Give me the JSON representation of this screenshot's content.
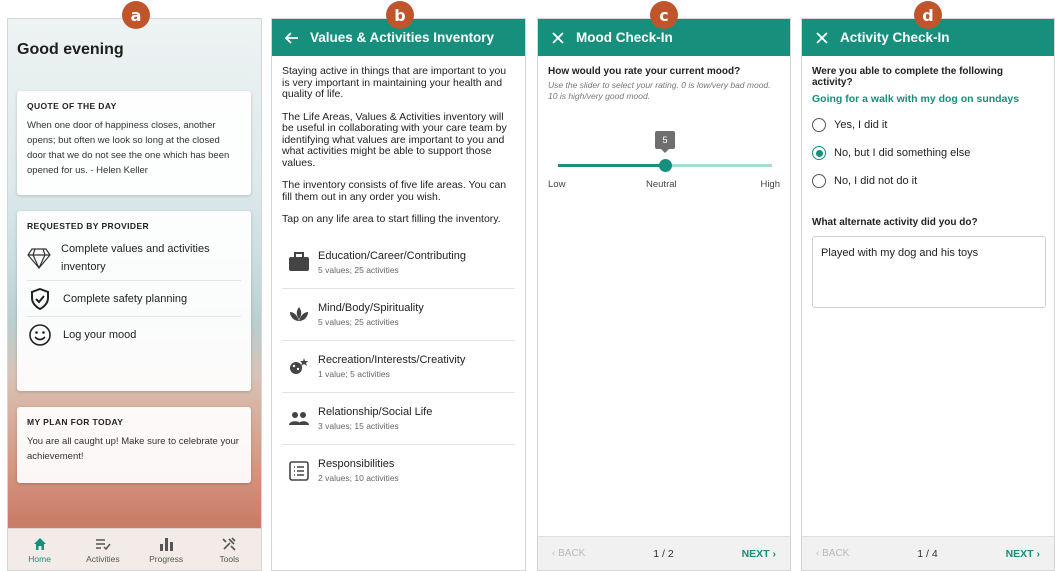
{
  "badges": {
    "a": "a",
    "b": "b",
    "c": "c",
    "d": "d"
  },
  "home": {
    "greeting": "Good evening",
    "quote": {
      "title": "QUOTE OF THE DAY",
      "text": "When one door of happiness closes, another opens; but often we look so long at the closed door that we do not see the one which has been opened for us. - Helen Keller"
    },
    "requested": {
      "title": "REQUESTED BY PROVIDER",
      "items": [
        {
          "label": "Complete values and activities inventory",
          "icon": "diamond-icon"
        },
        {
          "label": "Complete safety planning",
          "icon": "shield-check-icon"
        },
        {
          "label": "Log your mood",
          "icon": "smiley-icon"
        }
      ]
    },
    "plan": {
      "title": "MY PLAN FOR TODAY",
      "text": "You are all caught up! Make sure to celebrate your achievement!"
    },
    "nav": [
      {
        "label": "Home",
        "icon": "home-icon",
        "active": true
      },
      {
        "label": "Activities",
        "icon": "checklist-icon",
        "active": false
      },
      {
        "label": "Progress",
        "icon": "bar-chart-icon",
        "active": false
      },
      {
        "label": "Tools",
        "icon": "tools-icon",
        "active": false
      }
    ],
    "colors": {
      "accent": "#168f7d"
    }
  },
  "inventory": {
    "title": "Values & Activities Inventory",
    "paragraphs": [
      "Staying active in things that are important to you is very important in maintaining your health and quality of life.",
      "The Life Areas, Values & Activities inventory will be useful in collaborating with your care team by identifying what values are important to you and what activities might be able to support those values.",
      "The inventory consists of five life areas. You can fill them out in any order you wish.",
      "Tap on any life area to start filling the inventory."
    ],
    "areas": [
      {
        "name": "Education/Career/Contributing",
        "sub": "5 values; 25 activities",
        "icon": "briefcase-icon"
      },
      {
        "name": "Mind/Body/Spirituality",
        "sub": "5 values; 25 activities",
        "icon": "lotus-icon"
      },
      {
        "name": "Recreation/Interests/Creativity",
        "sub": "1 value; 5 activities",
        "icon": "palette-icon"
      },
      {
        "name": "Relationship/Social Life",
        "sub": "3 values; 15 activities",
        "icon": "people-icon"
      },
      {
        "name": "Responsibilities",
        "sub": "2 values; 10 activities",
        "icon": "list-icon"
      }
    ]
  },
  "mood": {
    "title": "Mood Check-In",
    "question": "How would you rate your current mood?",
    "hint": "Use the slider to select your rating. 0 is low/very bad mood. 10 is high/very good mood.",
    "value": "5",
    "value_fraction": 0.5,
    "low": "Low",
    "mid": "Neutral",
    "high": "High",
    "back": "‹ BACK",
    "page": "1 / 2",
    "next": "NEXT ›"
  },
  "activity": {
    "title": "Activity Check-In",
    "question": "Were you able to complete the following activity?",
    "activity_name": "Going for a walk with my dog on sundays",
    "options": [
      {
        "label": "Yes, I did it",
        "selected": false
      },
      {
        "label": "No, but I did something else",
        "selected": true
      },
      {
        "label": "No, I did not do it",
        "selected": false
      }
    ],
    "alt_question": "What alternate activity did you do?",
    "alt_answer": "Played with my dog and his toys",
    "back": "‹ BACK",
    "page": "1 / 4",
    "next": "NEXT ›"
  }
}
